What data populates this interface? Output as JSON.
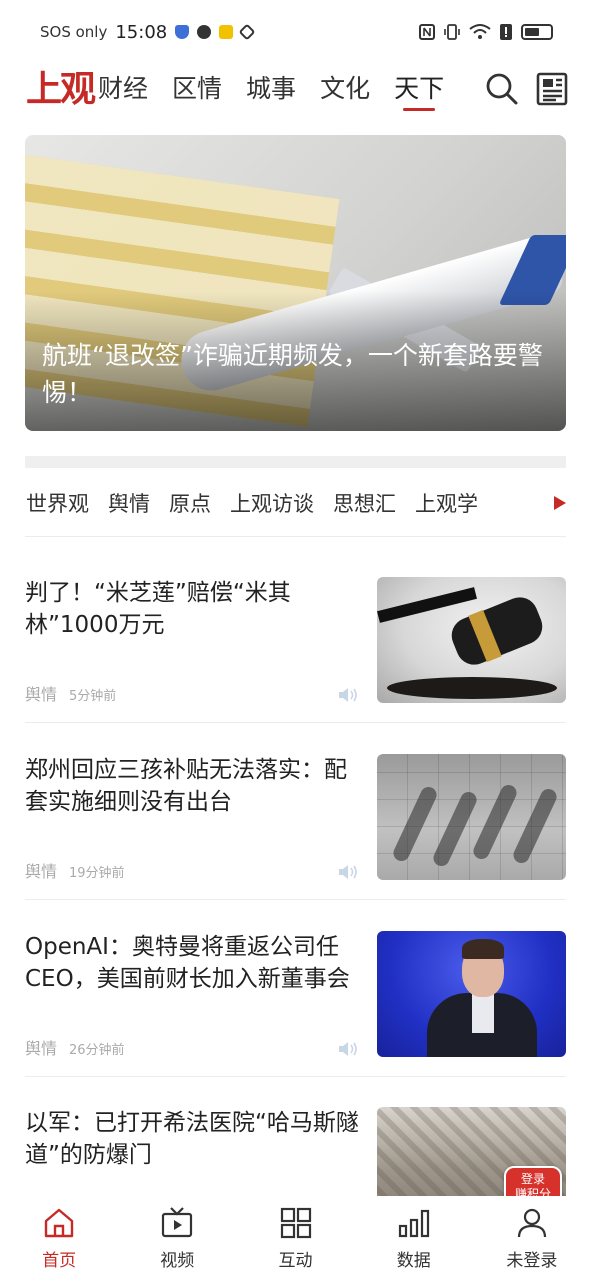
{
  "status_bar": {
    "carrier": "SOS only",
    "time": "15:08"
  },
  "top_nav": {
    "logo": "上观",
    "tabs": [
      {
        "label": "财经",
        "active": false
      },
      {
        "label": "区情",
        "active": false
      },
      {
        "label": "城事",
        "active": false
      },
      {
        "label": "文化",
        "active": false
      },
      {
        "label": "天下",
        "active": true
      }
    ],
    "icons": [
      "search-icon",
      "newspaper-icon"
    ]
  },
  "banner": {
    "title": "航班“退改签”诈骗近期频发，一个新套路要警惕！"
  },
  "sub_channels": [
    "世界观",
    "舆情",
    "原点",
    "上观访谈",
    "思想汇",
    "上观学"
  ],
  "news": [
    {
      "title": "判了！“米芝莲”赔偿“米其林”1000万元",
      "source": "舆情",
      "time": "5分钟前"
    },
    {
      "title": "郑州回应三孩补贴无法落实：配套实施细则没有出台",
      "source": "舆情",
      "time": "19分钟前"
    },
    {
      "title": "OpenAI：奥特曼将重返公司任CEO，美国前财长加入新董事会",
      "source": "舆情",
      "time": "26分钟前"
    },
    {
      "title": "以军：已打开希法医院“哈马斯隧道”的防爆门",
      "source": "",
      "time": ""
    }
  ],
  "points_badge": {
    "line1": "登录",
    "line2": "赚积分"
  },
  "bottom_tabs": [
    {
      "label": "首页",
      "icon": "home-icon",
      "active": true
    },
    {
      "label": "视频",
      "icon": "video-icon",
      "active": false
    },
    {
      "label": "互动",
      "icon": "grid-icon",
      "active": false
    },
    {
      "label": "数据",
      "icon": "bar-chart-icon",
      "active": false
    },
    {
      "label": "未登录",
      "icon": "user-icon",
      "active": false
    }
  ],
  "colors": {
    "brand": "#c62a26",
    "text": "#222222",
    "muted": "#aaaaaa"
  }
}
